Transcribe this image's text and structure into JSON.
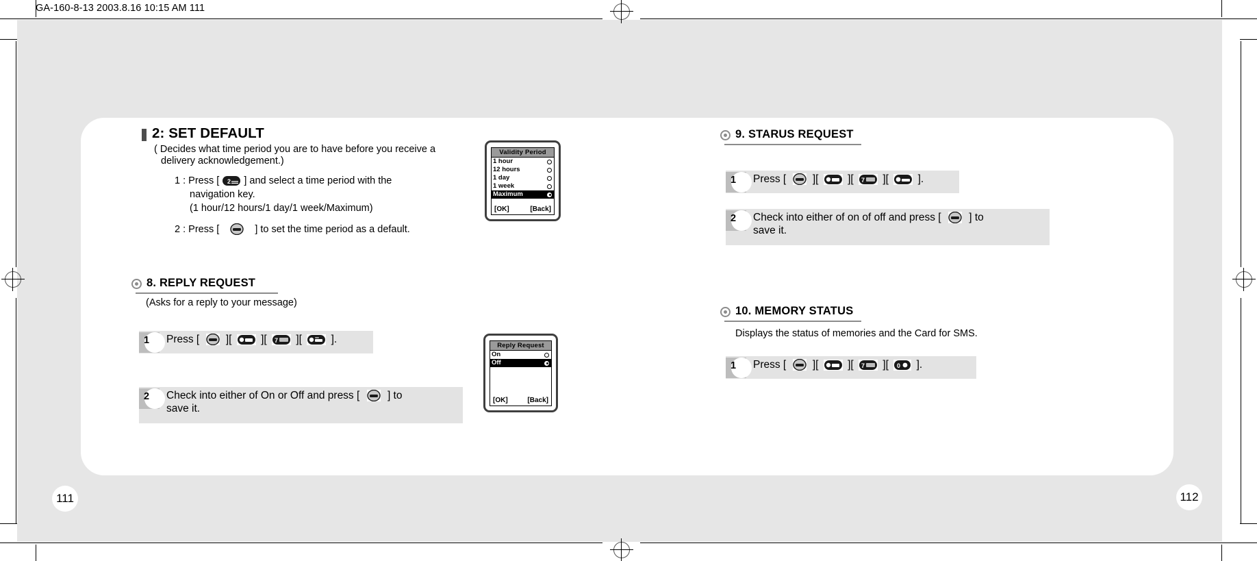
{
  "imprint": {
    "text": "GA-160-8-13      2003.8.16 10:15 AM      111"
  },
  "pages": {
    "left": "111",
    "right": "112"
  },
  "left_page": {
    "set_default": {
      "title": "2: SET DEFAULT",
      "desc_line1": "( Decides what time period you are to have before you receive a",
      "desc_line2": "delivery acknowledgement.)",
      "step1_a": "1 : Press [",
      "step1_b": "] and select a time period with the",
      "step1_line2": "navigation key.",
      "step1_line3": "(1 hour/12 hours/1 day/1 week/Maximum)",
      "step2_a": "2 : Press [",
      "step2_b": "] to set the time period as a  default."
    },
    "reply_request": {
      "title": "8. REPLY REQUEST",
      "subtitle": "(Asks for a reply to your message)",
      "step1": {
        "num": "1",
        "press_label": "Press [",
        "sep1": "][",
        "sep2": "][",
        "sep3": "][",
        "end": "]."
      },
      "step2": {
        "num": "2",
        "line1_a": "Check into either of On or Off and press [",
        "line1_b": "] to",
        "line2": "save it."
      }
    },
    "validity_screen": {
      "title": "Validity Period",
      "options": [
        {
          "label": "1 hour",
          "selected": false
        },
        {
          "label": "12 hours",
          "selected": false
        },
        {
          "label": "1 day",
          "selected": false
        },
        {
          "label": "1 week",
          "selected": false
        },
        {
          "label": "Maximum",
          "selected": true
        }
      ],
      "softkey_left": "[OK]",
      "softkey_right": "[Back]"
    },
    "reply_screen": {
      "title": "Reply Request",
      "options": [
        {
          "label": "On",
          "selected": false
        },
        {
          "label": "Off",
          "selected": true
        }
      ],
      "softkey_left": "[OK]",
      "softkey_right": "[Back]"
    }
  },
  "right_page": {
    "status_request": {
      "title": "9. STARUS REQUEST",
      "step1": {
        "num": "1",
        "press_label": "Press [",
        "sep1": "][",
        "sep2": "][",
        "sep3": "][",
        "end": "]."
      },
      "step2": {
        "num": "2",
        "line1_a": "Check into either of on of off and press [",
        "line1_b": "] to",
        "line2": "save it."
      }
    },
    "memory_status": {
      "title": "10. MEMORY STATUS",
      "subtitle": "Displays the status of memories and the Card for SMS.",
      "step1": {
        "num": "1",
        "press_label": "Press [",
        "sep1": "][",
        "sep2": "][",
        "sep3": "][",
        "end": "]."
      }
    }
  },
  "icons": {
    "ok_key": "ok-key-icon",
    "key_2": "keypad-2-icon",
    "menu_key": "menu-key-icon",
    "nav_key": "navigation-key-icon",
    "select_key": "select-key-icon",
    "zero_key": "keypad-0-icon"
  },
  "colors": {
    "sheet": "#e6e6e6",
    "panel": "#ffffff",
    "step_band": "#e3e3e3",
    "badge": "#bdbdbd",
    "rule": "#8c8c8c",
    "screen_title_bar": "#9a9a9a"
  }
}
